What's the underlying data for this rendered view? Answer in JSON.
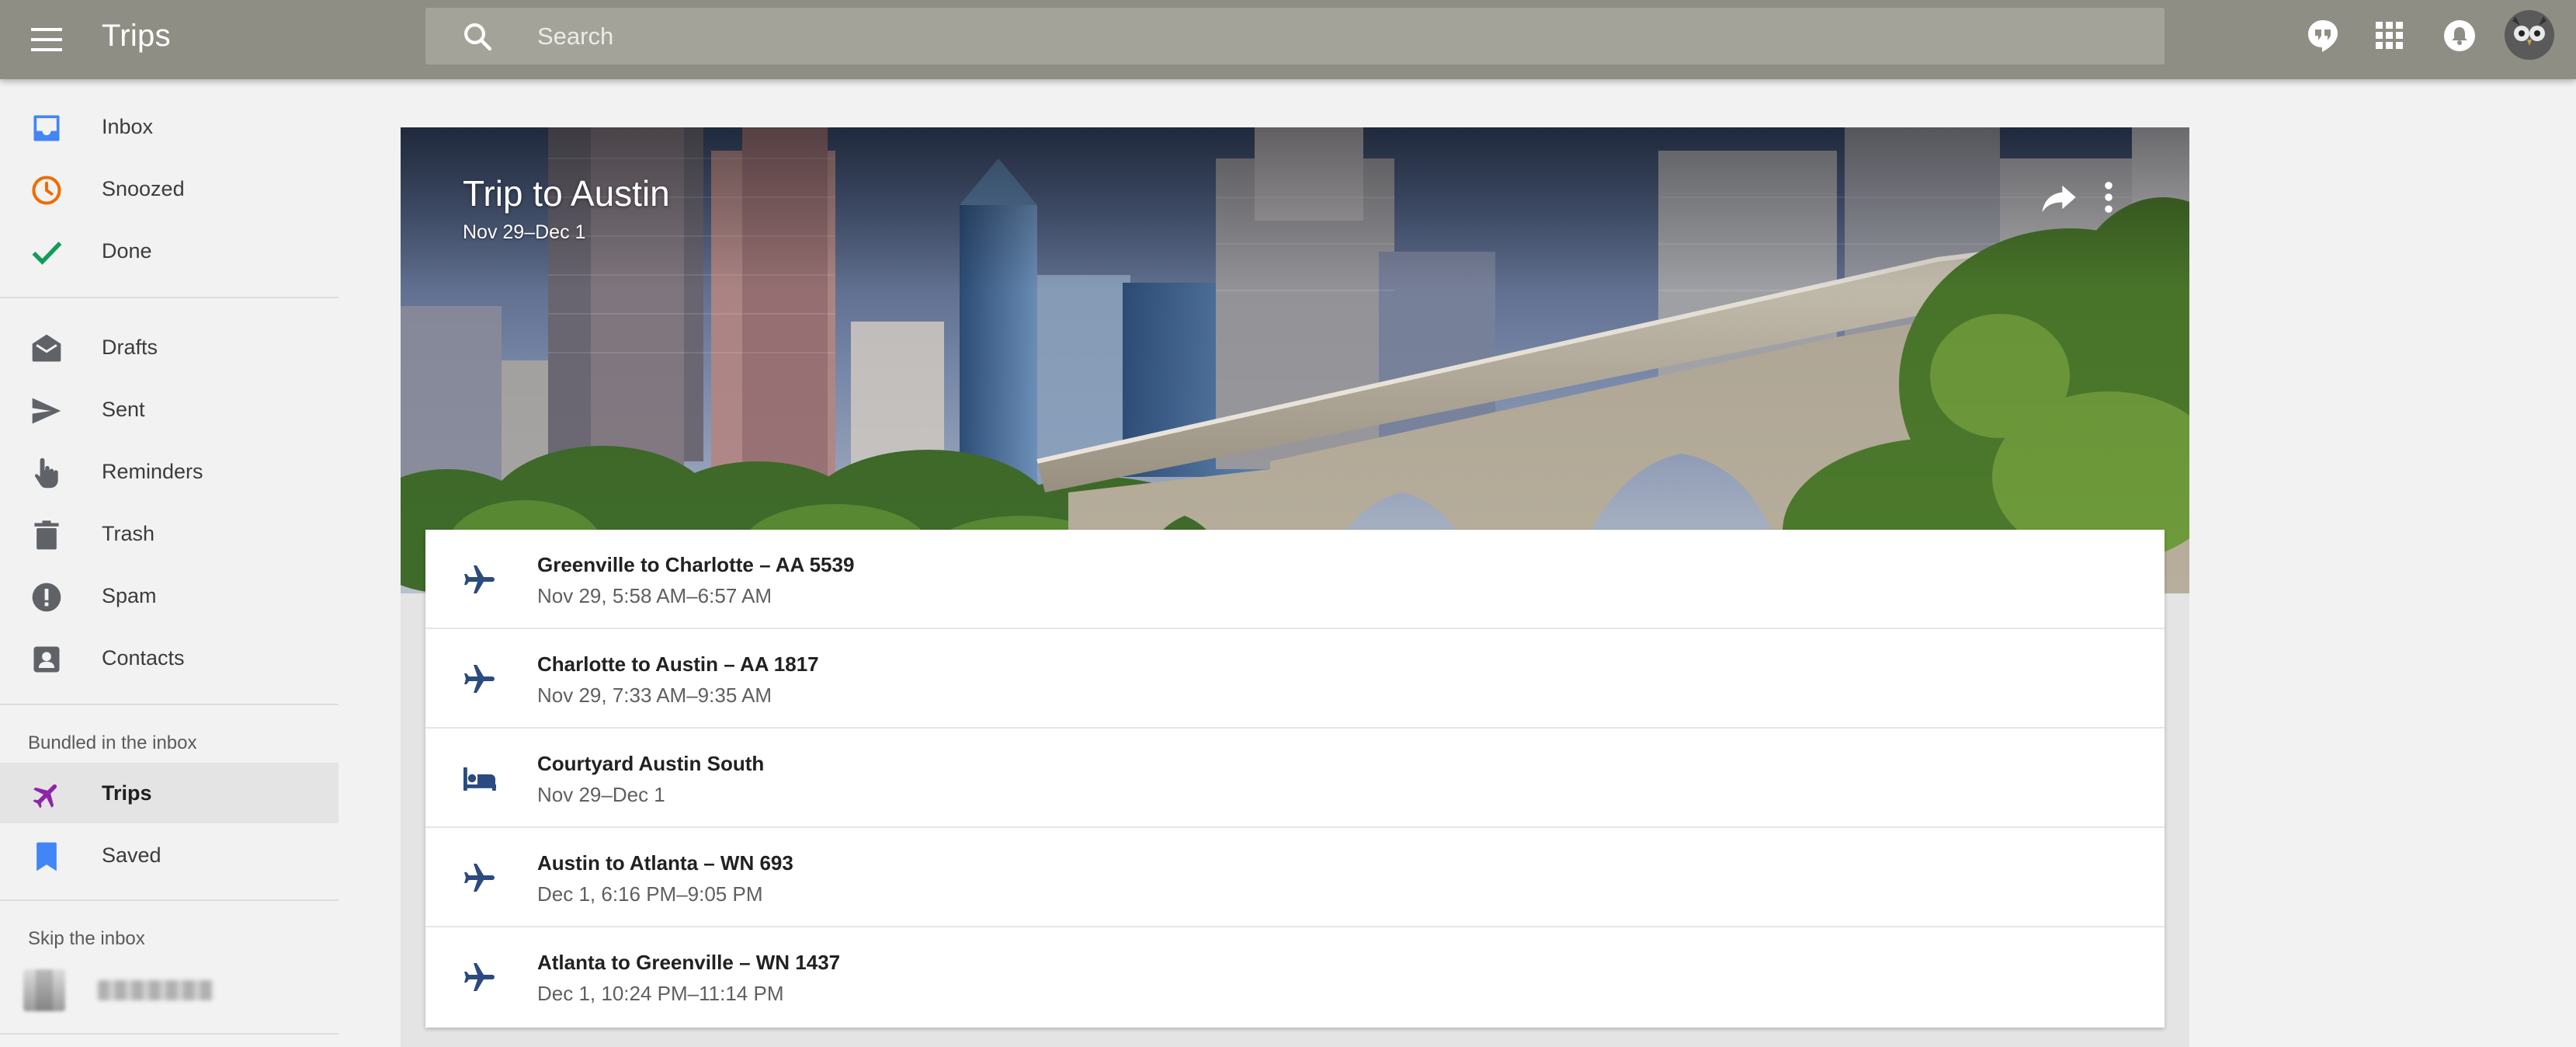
{
  "app": {
    "title": "Trips"
  },
  "search": {
    "placeholder": "Search"
  },
  "topbar_icons": [
    "hangouts-icon",
    "apps-grid-icon",
    "notifications-icon"
  ],
  "colors": {
    "topbar": "#8f8e84",
    "inbox_blue": "#4285f4",
    "snoozed_orange": "#ef6c00",
    "done_green": "#0f9d58",
    "trips_purple": "#8e24aa",
    "plane_blue": "#2b4a80"
  },
  "sidebar": {
    "primary": [
      {
        "label": "Inbox",
        "icon": "inbox-icon"
      },
      {
        "label": "Snoozed",
        "icon": "clock-icon"
      },
      {
        "label": "Done",
        "icon": "checkmark-icon"
      }
    ],
    "secondary": [
      {
        "label": "Drafts",
        "icon": "envelope-open-icon"
      },
      {
        "label": "Sent",
        "icon": "send-icon"
      },
      {
        "label": "Reminders",
        "icon": "pointing-hand-icon"
      },
      {
        "label": "Trash",
        "icon": "trash-icon"
      },
      {
        "label": "Spam",
        "icon": "alert-icon"
      },
      {
        "label": "Contacts",
        "icon": "contact-card-icon"
      }
    ],
    "bundled_header": "Bundled in the inbox",
    "bundled": [
      {
        "label": "Trips",
        "icon": "airplane-icon",
        "active": true
      },
      {
        "label": "Saved",
        "icon": "bookmark-icon"
      }
    ],
    "skip_header": "Skip the inbox"
  },
  "trip": {
    "title": "Trip to Austin",
    "dates": "Nov 29–Dec 1",
    "items": [
      {
        "icon": "airplane-icon",
        "title": "Greenville to Charlotte – AA 5539",
        "subtitle": "Nov 29, 5:58 AM–6:57 AM"
      },
      {
        "icon": "airplane-icon",
        "title": "Charlotte to Austin – AA 1817",
        "subtitle": "Nov 29, 7:33 AM–9:35 AM"
      },
      {
        "icon": "hotel-bed-icon",
        "title": "Courtyard Austin South",
        "subtitle": "Nov 29–Dec 1"
      },
      {
        "icon": "airplane-icon",
        "title": "Austin to Atlanta – WN 693",
        "subtitle": "Dec 1, 6:16 PM–9:05 PM"
      },
      {
        "icon": "airplane-icon",
        "title": "Atlanta to Greenville – WN 1437",
        "subtitle": "Dec 1, 10:24 PM–11:14 PM"
      }
    ]
  }
}
